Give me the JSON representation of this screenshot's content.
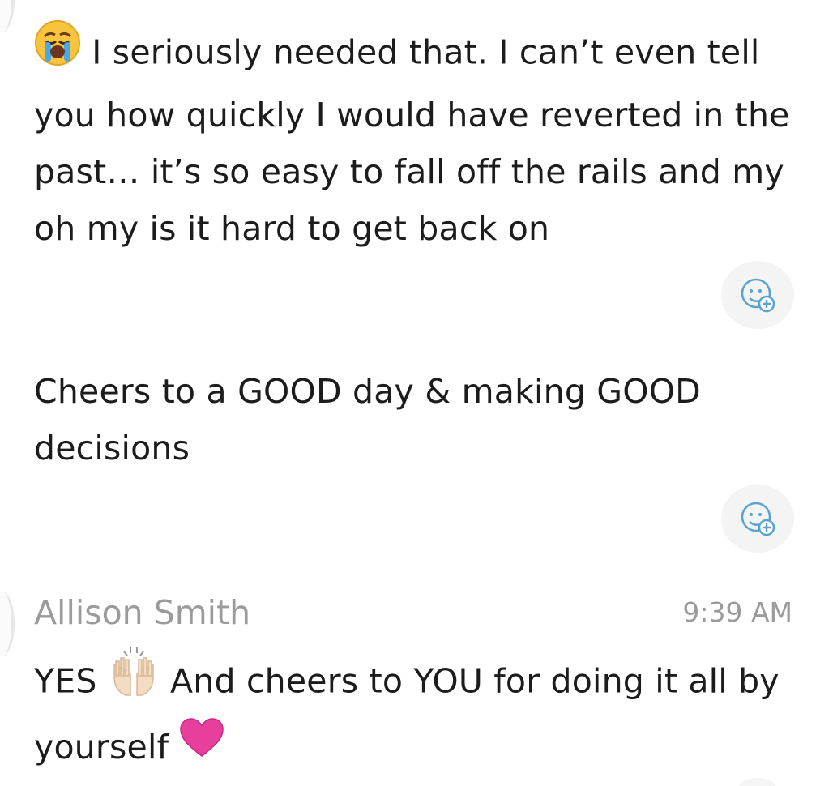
{
  "messages": [
    {
      "emoji": "loudly-crying-face-icon",
      "text": "I seriously needed that. I can’t even tell you how quickly I would have reverted in the past… it’s so easy to fall off the rails and my oh my is it hard to get back on"
    },
    {
      "text": "Cheers to a GOOD day & making GOOD decisions"
    },
    {
      "sender": "Allison Smith",
      "timestamp": "9:39 AM",
      "text_before": "YES",
      "emoji_1": "raising-hands-icon",
      "text_after": "And cheers to YOU for doing it all by yourself",
      "emoji_2": "pink-heart-icon"
    }
  ],
  "colors": {
    "text": "#1c1c1c",
    "muted": "#9b9b9b",
    "reaction_bg": "#f4f4f4",
    "reaction_icon": "#5aa3cf",
    "heart": "#e83e9c"
  }
}
